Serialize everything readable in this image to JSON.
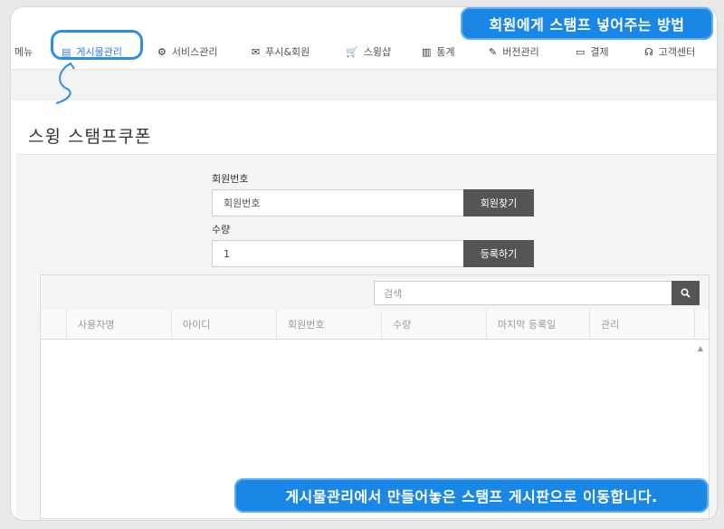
{
  "nav": {
    "items": [
      {
        "label": "메뉴",
        "icon": ""
      },
      {
        "label": "게시물관리",
        "icon": "list-icon",
        "glyph": "▤"
      },
      {
        "label": "서비스관리",
        "icon": "gear-icon",
        "glyph": "⚙"
      },
      {
        "label": "푸시&회원",
        "icon": "envelope-icon",
        "glyph": "✉"
      },
      {
        "label": "스윙샵",
        "icon": "cart-icon",
        "glyph": "🛒"
      },
      {
        "label": "통계",
        "icon": "bar-chart-icon",
        "glyph": "▥"
      },
      {
        "label": "버전관리",
        "icon": "wrench-icon",
        "glyph": "✎"
      },
      {
        "label": "결제",
        "icon": "card-icon",
        "glyph": "▭"
      },
      {
        "label": "고객센터",
        "icon": "headset-icon",
        "glyph": "☊"
      }
    ]
  },
  "page": {
    "title": "스윙 스탬프쿠폰"
  },
  "form": {
    "member_label": "회원번호",
    "member_placeholder": "회원번호",
    "find_button": "회원찾기",
    "qty_label": "수량",
    "qty_value": "1",
    "register_button": "등록하기"
  },
  "grid": {
    "search_placeholder": "검색",
    "columns": [
      "사용자명",
      "아이디",
      "회원번호",
      "수량",
      "마지막 등록일",
      "관리"
    ]
  },
  "callouts": {
    "top": "회원에게 스탬프 넣어주는 방법",
    "bottom": "게시물관리에서 만들어놓은 스탬프 게시판으로 이동합니다."
  },
  "colors": {
    "accent": "#1a86e6",
    "dark_button": "#555555"
  }
}
